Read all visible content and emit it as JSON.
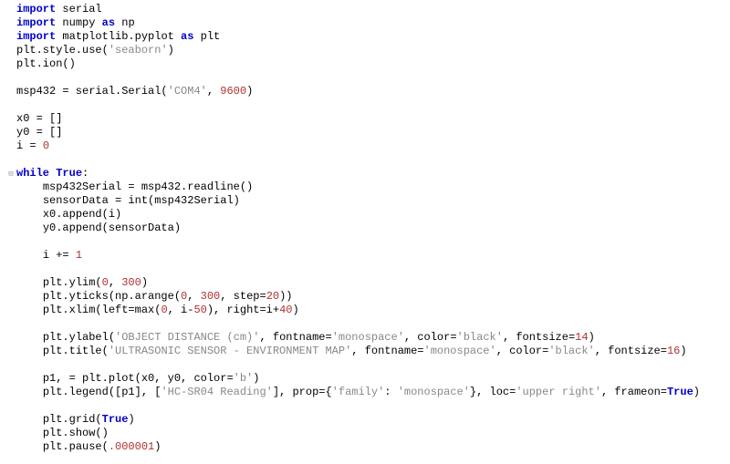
{
  "colors": {
    "keyword": "#0000cc",
    "string": "#888888",
    "number": "#b03030",
    "text": "#000000",
    "background": "#ffffff"
  },
  "code": {
    "lines": [
      {
        "type": "code",
        "tokens": [
          {
            "t": "import ",
            "c": "kw"
          },
          {
            "t": "serial"
          }
        ]
      },
      {
        "type": "code",
        "tokens": [
          {
            "t": "import ",
            "c": "kw"
          },
          {
            "t": "numpy "
          },
          {
            "t": "as ",
            "c": "kw"
          },
          {
            "t": "np"
          }
        ]
      },
      {
        "type": "code",
        "tokens": [
          {
            "t": "import ",
            "c": "kw"
          },
          {
            "t": "matplotlib.pyplot "
          },
          {
            "t": "as ",
            "c": "kw"
          },
          {
            "t": "plt"
          }
        ]
      },
      {
        "type": "code",
        "tokens": [
          {
            "t": "plt.style.use("
          },
          {
            "t": "'seaborn'",
            "c": "str"
          },
          {
            "t": ")"
          }
        ]
      },
      {
        "type": "code",
        "tokens": [
          {
            "t": "plt.ion()"
          }
        ]
      },
      {
        "type": "blank"
      },
      {
        "type": "code",
        "tokens": [
          {
            "t": "msp432 = serial.Serial("
          },
          {
            "t": "'COM4'",
            "c": "str"
          },
          {
            "t": ", "
          },
          {
            "t": "9600",
            "c": "num"
          },
          {
            "t": ")"
          }
        ]
      },
      {
        "type": "blank"
      },
      {
        "type": "code",
        "tokens": [
          {
            "t": "x0 = []"
          }
        ]
      },
      {
        "type": "code",
        "tokens": [
          {
            "t": "y0 = []"
          }
        ]
      },
      {
        "type": "code",
        "tokens": [
          {
            "t": "i = "
          },
          {
            "t": "0",
            "c": "num"
          }
        ]
      },
      {
        "type": "blank"
      },
      {
        "type": "code",
        "fold": true,
        "tokens": [
          {
            "t": "while ",
            "c": "kw"
          },
          {
            "t": "True",
            "c": "bool"
          },
          {
            "t": ":"
          }
        ]
      },
      {
        "type": "code",
        "indent": 1,
        "tokens": [
          {
            "t": "msp432Serial = msp432.readline()"
          }
        ]
      },
      {
        "type": "code",
        "indent": 1,
        "tokens": [
          {
            "t": "sensorData = int(msp432Serial)"
          }
        ]
      },
      {
        "type": "code",
        "indent": 1,
        "tokens": [
          {
            "t": "x0.append(i)"
          }
        ]
      },
      {
        "type": "code",
        "indent": 1,
        "tokens": [
          {
            "t": "y0.append(sensorData)"
          }
        ]
      },
      {
        "type": "blank"
      },
      {
        "type": "code",
        "indent": 1,
        "tokens": [
          {
            "t": "i += "
          },
          {
            "t": "1",
            "c": "num"
          }
        ]
      },
      {
        "type": "blank"
      },
      {
        "type": "code",
        "indent": 1,
        "tokens": [
          {
            "t": "plt.ylim("
          },
          {
            "t": "0",
            "c": "num"
          },
          {
            "t": ", "
          },
          {
            "t": "300",
            "c": "num"
          },
          {
            "t": ")"
          }
        ]
      },
      {
        "type": "code",
        "indent": 1,
        "tokens": [
          {
            "t": "plt.yticks(np.arange("
          },
          {
            "t": "0",
            "c": "num"
          },
          {
            "t": ", "
          },
          {
            "t": "300",
            "c": "num"
          },
          {
            "t": ", step="
          },
          {
            "t": "20",
            "c": "num"
          },
          {
            "t": "))"
          }
        ]
      },
      {
        "type": "code",
        "indent": 1,
        "tokens": [
          {
            "t": "plt.xlim(left=max("
          },
          {
            "t": "0",
            "c": "num"
          },
          {
            "t": ", i-"
          },
          {
            "t": "50",
            "c": "num"
          },
          {
            "t": "), right=i+"
          },
          {
            "t": "40",
            "c": "num"
          },
          {
            "t": ")"
          }
        ]
      },
      {
        "type": "blank"
      },
      {
        "type": "code",
        "indent": 1,
        "tokens": [
          {
            "t": "plt.ylabel("
          },
          {
            "t": "'OBJECT DISTANCE (cm)'",
            "c": "str"
          },
          {
            "t": ", fontname="
          },
          {
            "t": "'monospace'",
            "c": "str"
          },
          {
            "t": ", color="
          },
          {
            "t": "'black'",
            "c": "str"
          },
          {
            "t": ", fontsize="
          },
          {
            "t": "14",
            "c": "num"
          },
          {
            "t": ")"
          }
        ]
      },
      {
        "type": "code",
        "indent": 1,
        "tokens": [
          {
            "t": "plt.title("
          },
          {
            "t": "'ULTRASONIC SENSOR - ENVIRONMENT MAP'",
            "c": "str"
          },
          {
            "t": ", fontname="
          },
          {
            "t": "'monospace'",
            "c": "str"
          },
          {
            "t": ", color="
          },
          {
            "t": "'black'",
            "c": "str"
          },
          {
            "t": ", fontsize="
          },
          {
            "t": "16",
            "c": "num"
          },
          {
            "t": ")"
          }
        ]
      },
      {
        "type": "blank"
      },
      {
        "type": "code",
        "indent": 1,
        "tokens": [
          {
            "t": "p1, = plt.plot(x0, y0, color="
          },
          {
            "t": "'b'",
            "c": "str"
          },
          {
            "t": ")"
          }
        ]
      },
      {
        "type": "code",
        "indent": 1,
        "tokens": [
          {
            "t": "plt.legend([p1], ["
          },
          {
            "t": "'HC-SR04 Reading'",
            "c": "str"
          },
          {
            "t": "], prop={"
          },
          {
            "t": "'family'",
            "c": "str"
          },
          {
            "t": ": "
          },
          {
            "t": "'monospace'",
            "c": "str"
          },
          {
            "t": "}, loc="
          },
          {
            "t": "'upper right'",
            "c": "str"
          },
          {
            "t": ", frameon="
          },
          {
            "t": "True",
            "c": "bool"
          },
          {
            "t": ")"
          }
        ]
      },
      {
        "type": "blank"
      },
      {
        "type": "code",
        "indent": 1,
        "tokens": [
          {
            "t": "plt.grid("
          },
          {
            "t": "True",
            "c": "bool"
          },
          {
            "t": ")"
          }
        ]
      },
      {
        "type": "code",
        "indent": 1,
        "tokens": [
          {
            "t": "plt.show()"
          }
        ]
      },
      {
        "type": "code",
        "indent": 1,
        "tokens": [
          {
            "t": "plt.pause("
          },
          {
            "t": ".000001",
            "c": "num"
          },
          {
            "t": ")"
          }
        ]
      }
    ]
  }
}
